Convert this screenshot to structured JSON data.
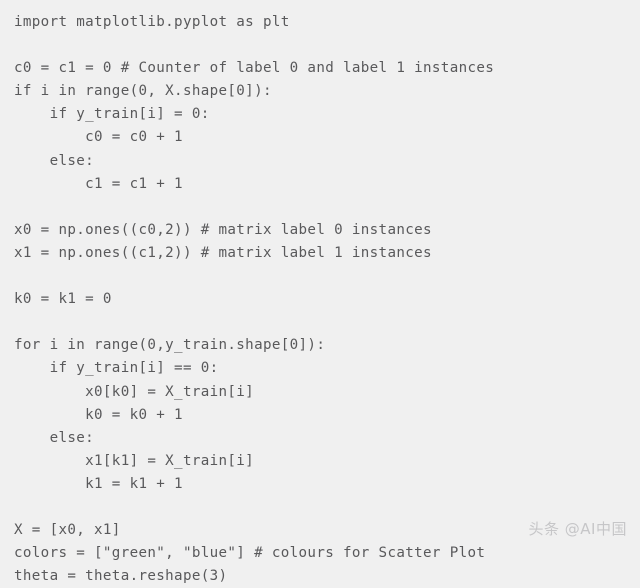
{
  "document": {
    "type": "code-snippet",
    "language": "python",
    "background_color": "#f0f0f0",
    "text_color": "#59595b",
    "code_lines": [
      "import matplotlib.pyplot as plt",
      "",
      "c0 = c1 = 0 # Counter of label 0 and label 1 instances",
      "if i in range(0, X.shape[0]):",
      "    if y_train[i] = 0:",
      "        c0 = c0 + 1",
      "    else:",
      "        c1 = c1 + 1",
      "",
      "x0 = np.ones((c0,2)) # matrix label 0 instances",
      "x1 = np.ones((c1,2)) # matrix label 1 instances",
      "",
      "k0 = k1 = 0",
      "",
      "for i in range(0,y_train.shape[0]):",
      "    if y_train[i] == 0:",
      "        x0[k0] = X_train[i]",
      "        k0 = k0 + 1",
      "    else:",
      "        x1[k1] = X_train[i]",
      "        k1 = k1 + 1",
      "",
      "X = [x0, x1]",
      "colors = [\"green\", \"blue\"] # colours for Scatter Plot",
      "theta = theta.reshape(3)"
    ]
  },
  "watermark": {
    "text": "头条 @AI中国",
    "color": "#c6c6c8"
  }
}
